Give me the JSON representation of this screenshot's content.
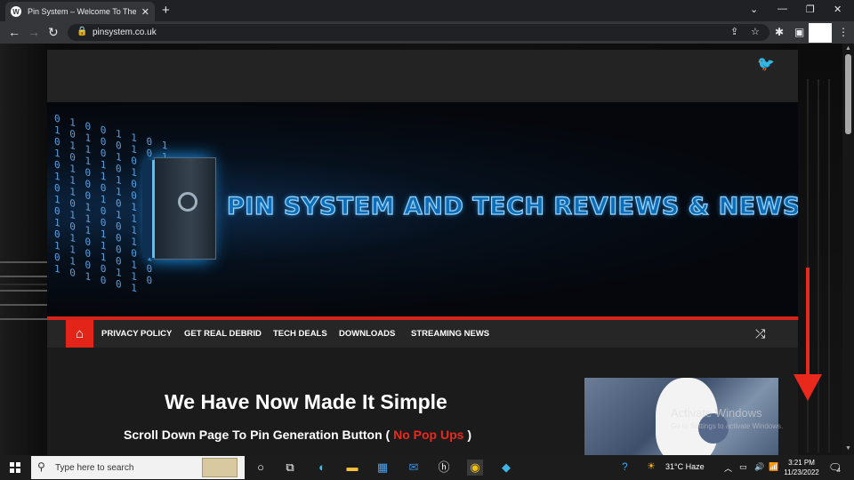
{
  "browser": {
    "tab_title": "Pin System – Welcome To The Ne",
    "new_tab_label": "+",
    "url": "pinsystem.co.uk"
  },
  "site": {
    "banner_title": "PIN SYSTEM AND TECH REVIEWS & NEWS",
    "binary_digits": "0 1 0 0 1 1 0 1\n1 0 1 0 0 1 0 1\n0 1 1 0 1 0 0 1\n1 0 1 1 0 1 0\n0 1 0 1 1 0 1 1\n1 1 0 0 1 0 1\n0 1 0 1 0 1 1\n1 0 1 0 1 1 0\n0 1 1 0 0 1 0\n1 0 1 1 0 1 1\n0 1 0 1 0 0 1\n1 1 0 1 0 1 0\n0 1 0 0 1 1 0\n1 0 1 0 0 1",
    "menu": [
      {
        "label": "PRIVACY POLICY"
      },
      {
        "label": "GET REAL DEBRID"
      },
      {
        "label": "TECH DEALS"
      },
      {
        "label": "DOWNLOADS"
      },
      {
        "label": "STREAMING NEWS"
      }
    ],
    "heading": "We Have Now Made It Simple",
    "subheading_pre": "Scroll Down Page To Pin Generation Button ( ",
    "subheading_highlight": "No Pop Ups",
    "subheading_post": " )"
  },
  "watermark": {
    "line1": "Activate Windows",
    "line2": "Go to Settings to activate Windows."
  },
  "taskbar": {
    "search_placeholder": "Type here to search",
    "weather": "31°C  Haze",
    "time": "3:21 PM",
    "date": "11/23/2022",
    "notification_count": "4"
  },
  "colors": {
    "accent_red": "#e32418",
    "twitter_blue": "#1da1f2",
    "banner_blue": "#0e6db8"
  }
}
